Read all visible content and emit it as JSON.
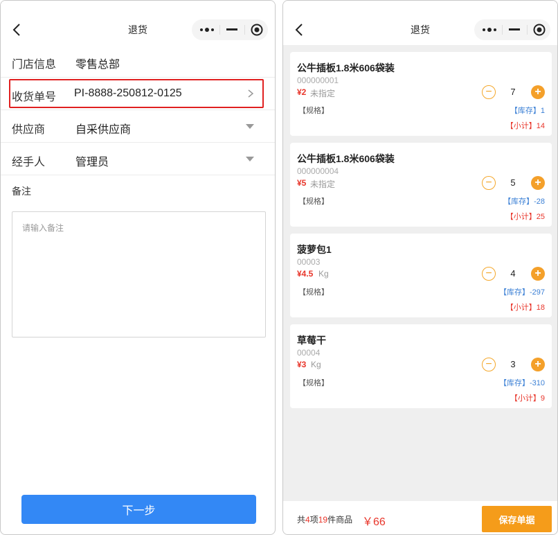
{
  "left": {
    "nav_title": "退货",
    "fields": [
      {
        "label": "门店信息",
        "value": "零售总部"
      },
      {
        "label": "收货单号",
        "value": "PI-8888-250812-0125"
      },
      {
        "label": "供应商",
        "value": "自采供应商"
      },
      {
        "label": "经手人",
        "value": "管理员"
      }
    ],
    "remark_label": "备注",
    "remark_placeholder": "请输入备注",
    "next_label": "下一步"
  },
  "right": {
    "nav_title": "退货",
    "products": [
      {
        "name": "公牛插板1.8米606袋装",
        "code": "000000001",
        "price": "¥2",
        "unit": "未指定",
        "spec": "【规格】",
        "qty": "7",
        "stock_label": "【库存】",
        "stock": "1",
        "subtotal_label": "【小计】",
        "subtotal": "14"
      },
      {
        "name": "公牛插板1.8米606袋装",
        "code": "000000004",
        "price": "¥5",
        "unit": "未指定",
        "spec": "【规格】",
        "qty": "5",
        "stock_label": "【库存】",
        "stock": "-28",
        "subtotal_label": "【小计】",
        "subtotal": "25"
      },
      {
        "name": "菠萝包1",
        "code": "00003",
        "price": "¥4.5",
        "unit": "Kg",
        "spec": "【规格】",
        "qty": "4",
        "stock_label": "【库存】",
        "stock": "-297",
        "subtotal_label": "【小计】",
        "subtotal": "18"
      },
      {
        "name": "草莓干",
        "code": "00004",
        "price": "¥3",
        "unit": "Kg",
        "spec": "【规格】",
        "qty": "3",
        "stock_label": "【库存】",
        "stock": "-310",
        "subtotal_label": "【小计】",
        "subtotal": "9"
      }
    ],
    "summary": {
      "prefix": "共",
      "items": "4",
      "mid": "项",
      "count": "19",
      "suffix": "件商品",
      "total": "￥66"
    },
    "save_label": "保存单据"
  },
  "colors": {
    "accent_blue": "#3388f5",
    "accent_orange": "#f59c1a",
    "price_red": "#e8352a",
    "stock_blue": "#3a7fd5",
    "highlight": "#e02020"
  },
  "icons": {
    "back": "chevron-left-icon",
    "more": "more-dots-icon",
    "minimize": "minimize-icon",
    "close": "target-circle-icon"
  }
}
